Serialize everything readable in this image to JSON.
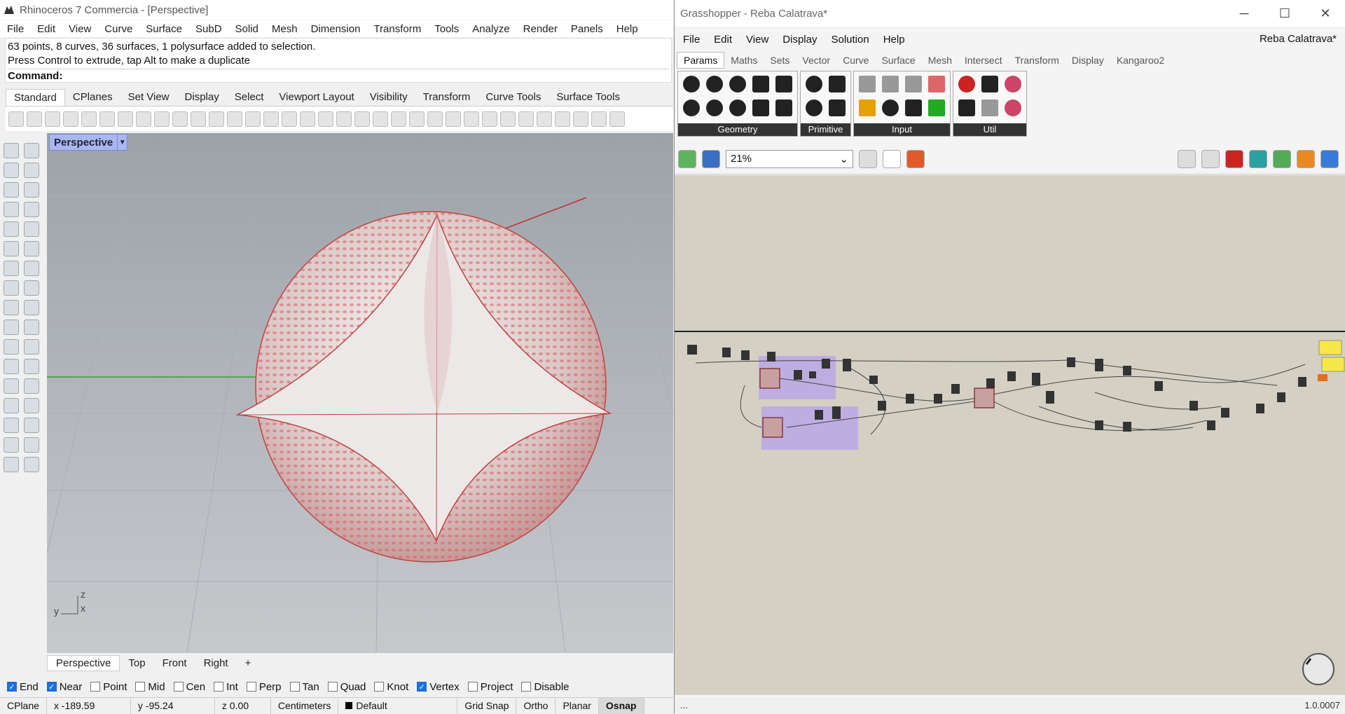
{
  "rhino": {
    "title": "Rhinoceros 7 Commercia - [Perspective]",
    "menu": [
      "File",
      "Edit",
      "View",
      "Curve",
      "Surface",
      "SubD",
      "Solid",
      "Mesh",
      "Dimension",
      "Transform",
      "Tools",
      "Analyze",
      "Render",
      "Panels",
      "Help"
    ],
    "command_history": [
      "63 points, 8 curves, 36 surfaces, 1 polysurface added to selection.",
      "Press Control to extrude, tap Alt to make a duplicate"
    ],
    "command_prompt": "Command:",
    "toolbar_tabs": [
      "Standard",
      "CPlanes",
      "Set View",
      "Display",
      "Select",
      "Viewport Layout",
      "Visibility",
      "Transform",
      "Curve Tools",
      "Surface Tools"
    ],
    "viewport_label": "Perspective",
    "viewport_tabs": [
      "Perspective",
      "Top",
      "Front",
      "Right"
    ],
    "viewport_add": "+",
    "axis": {
      "z": "z",
      "y": "y",
      "x": "x"
    },
    "osnaps": [
      {
        "label": "End",
        "on": true
      },
      {
        "label": "Near",
        "on": true
      },
      {
        "label": "Point",
        "on": false
      },
      {
        "label": "Mid",
        "on": false
      },
      {
        "label": "Cen",
        "on": false
      },
      {
        "label": "Int",
        "on": false
      },
      {
        "label": "Perp",
        "on": false
      },
      {
        "label": "Tan",
        "on": false
      },
      {
        "label": "Quad",
        "on": false
      },
      {
        "label": "Knot",
        "on": false
      },
      {
        "label": "Vertex",
        "on": true
      },
      {
        "label": "Project",
        "on": false
      },
      {
        "label": "Disable",
        "on": false
      }
    ],
    "status": {
      "cplane": "CPlane",
      "x": "x -189.59",
      "y": "y -95.24",
      "z": "z 0.00",
      "units": "Centimeters",
      "layer": "Default",
      "grid_snap": "Grid Snap",
      "ortho": "Ortho",
      "planar": "Planar",
      "osnap": "Osnap"
    }
  },
  "grasshopper": {
    "title": "Grasshopper - Reba Calatrava*",
    "menu": [
      "File",
      "Edit",
      "View",
      "Display",
      "Solution",
      "Help"
    ],
    "doc_name": "Reba Calatrava*",
    "tabs": [
      "Params",
      "Maths",
      "Sets",
      "Vector",
      "Curve",
      "Surface",
      "Mesh",
      "Intersect",
      "Transform",
      "Display",
      "Kangaroo2"
    ],
    "panels": [
      "Geometry",
      "Primitive",
      "Input",
      "Util"
    ],
    "zoom": "21%",
    "version": "1.0.0007",
    "status_left": "..."
  },
  "colors": {
    "accent": "#1e6fd9",
    "viewport_label": "#aab6ee",
    "gh_canvas": "#d4d0c4",
    "gh_group": "#b8a8e8",
    "surface_red": "#d64848"
  }
}
